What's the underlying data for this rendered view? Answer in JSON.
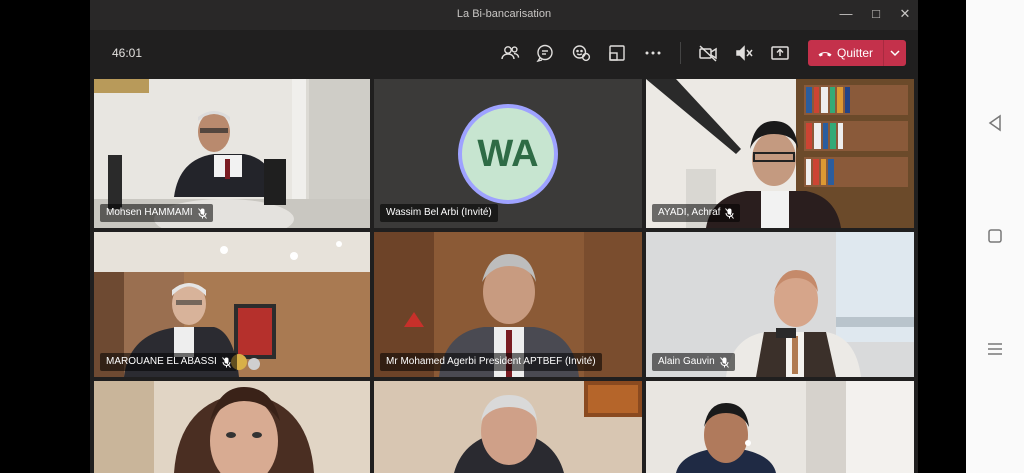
{
  "window": {
    "title": "La Bi-bancarisation",
    "controls": [
      "minimize-icon",
      "maximize-icon",
      "close-icon"
    ]
  },
  "toolbar": {
    "timer": "46:01",
    "icons": [
      "participants-icon",
      "chat-icon",
      "reactions-icon",
      "rooms-icon",
      "more-icon",
      "camera-off-icon",
      "mic-muted-icon",
      "share-screen-icon"
    ],
    "leave_label": "Quitter",
    "leave_color": "#c4314b"
  },
  "participants": [
    {
      "name": "Mohsen HAMMAMI",
      "muted": true
    },
    {
      "name": "Wassim Bel Arbi (Invité)",
      "initials": "WA",
      "avatar_color": "#c7e5d0"
    },
    {
      "name": "AYADI, Achraf",
      "muted": true
    },
    {
      "name": "MAROUANE EL ABASSI",
      "muted": true
    },
    {
      "name": "Mr Mohamed Agerbi President APTBEF (Invité)"
    },
    {
      "name": "Alain Gauvin",
      "muted": true
    },
    {
      "name": ""
    },
    {
      "name": ""
    },
    {
      "name": ""
    }
  ],
  "android_nav": [
    "back-icon",
    "home-icon",
    "recents-icon"
  ]
}
